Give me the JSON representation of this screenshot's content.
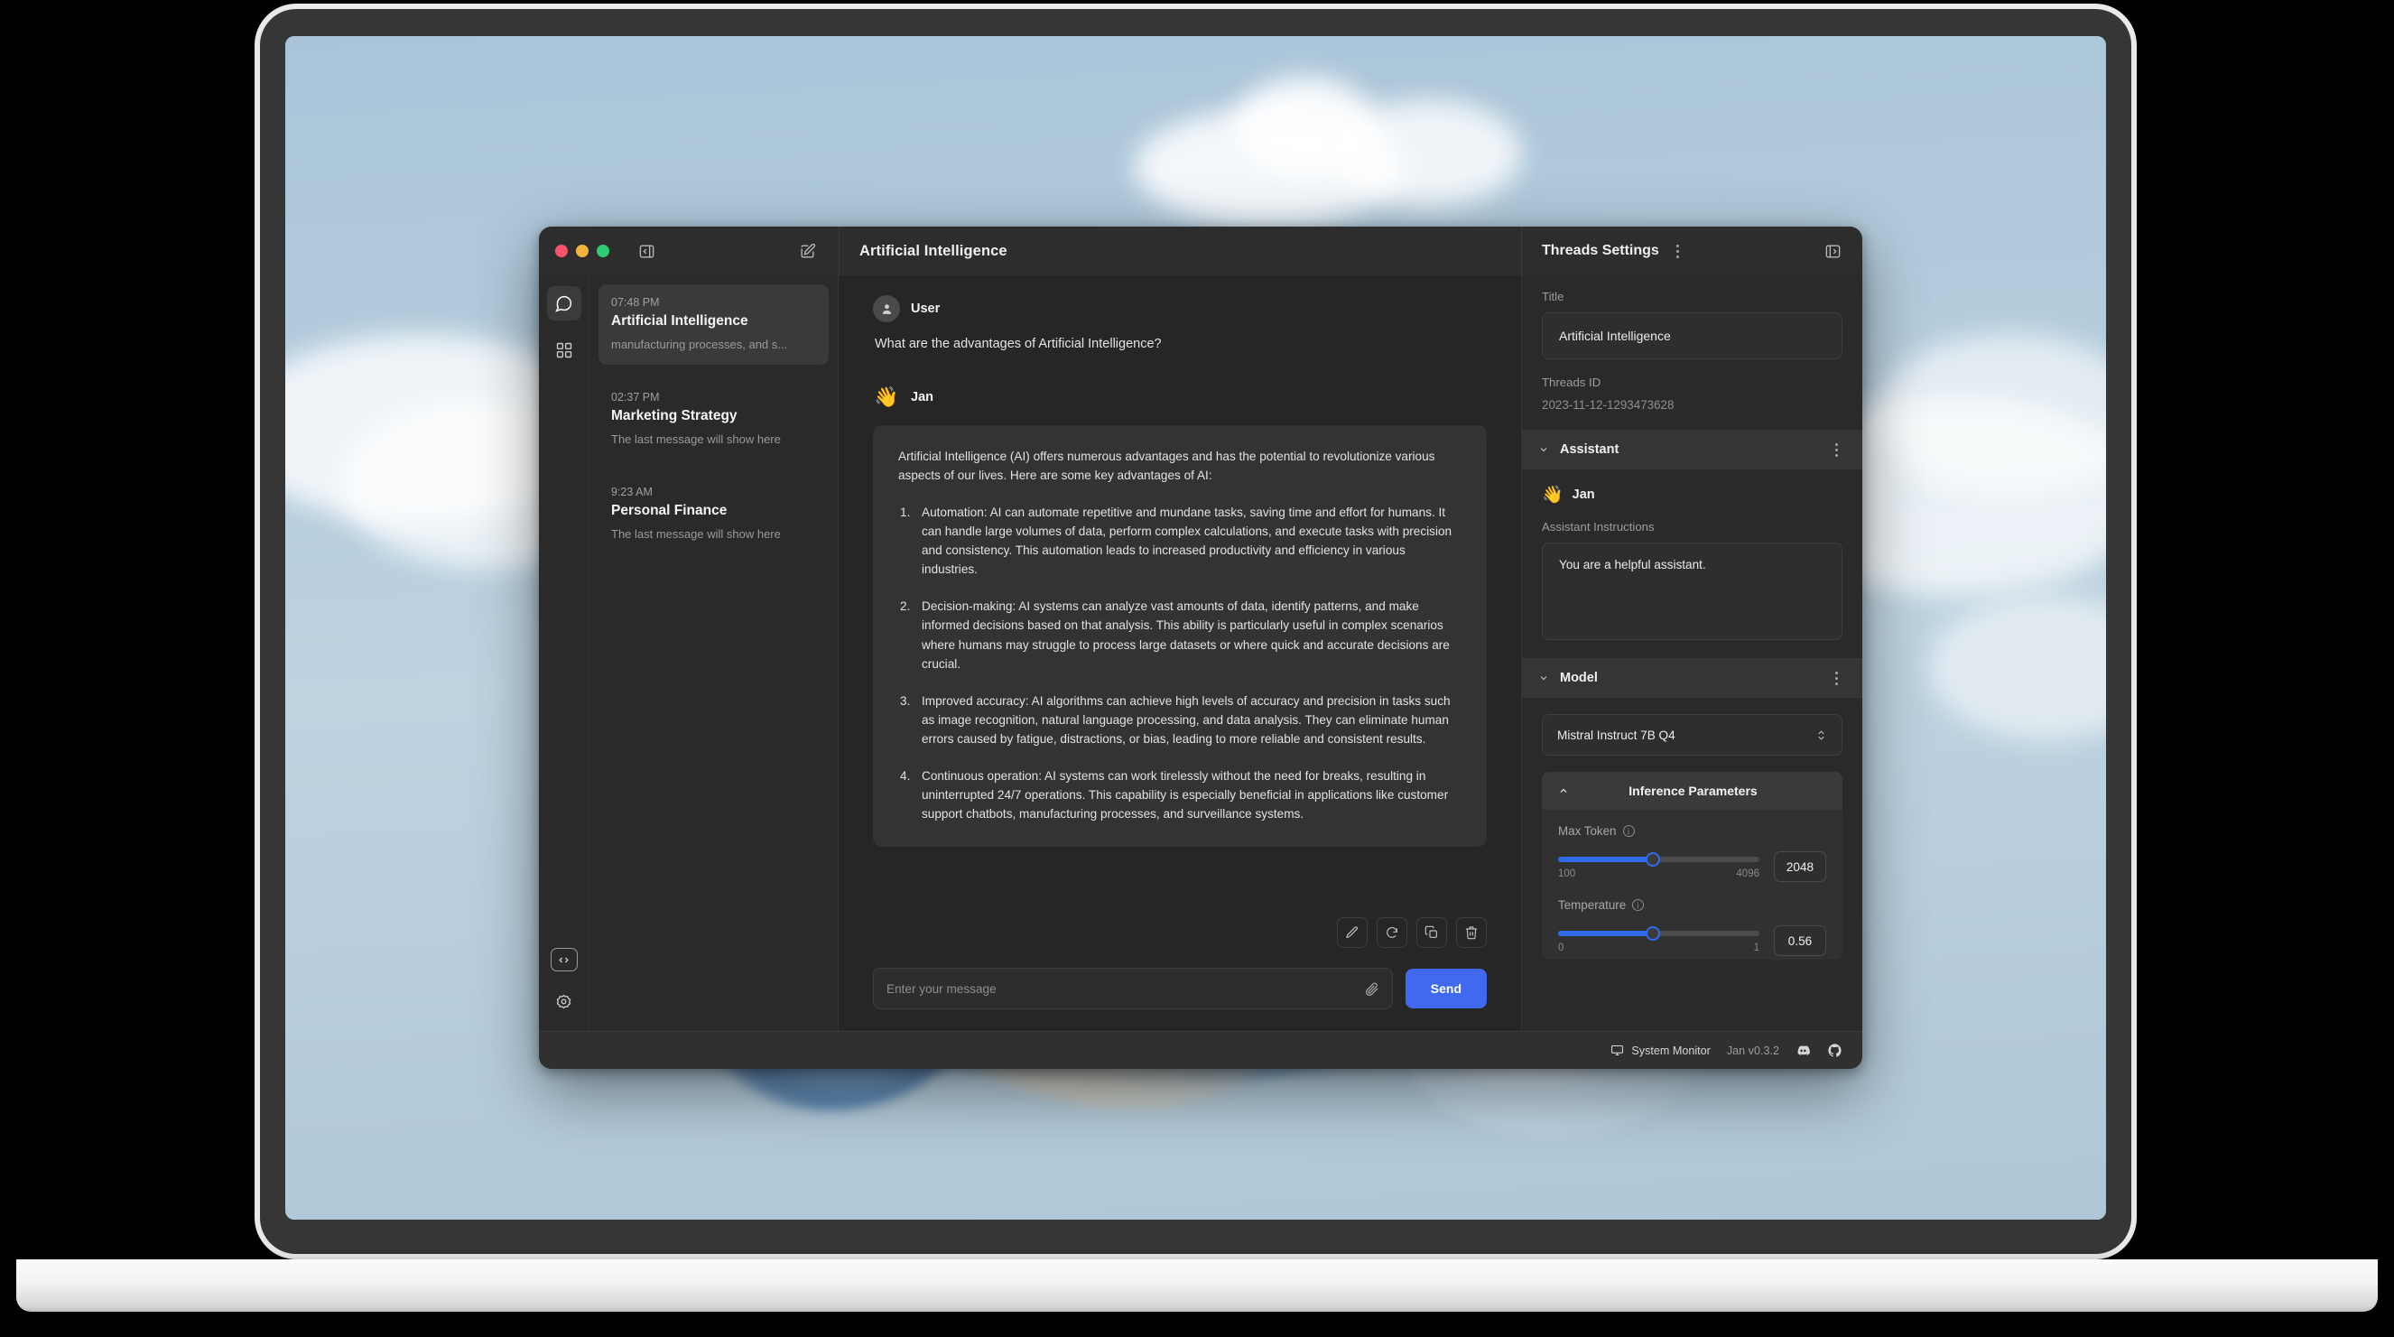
{
  "window": {
    "titlebar": {
      "toggle_left_panel_icon": "panel-left-collapse-icon",
      "new_thread_icon": "compose-pencil-square-icon",
      "chat_title": "Artificial Intelligence",
      "settings_title": "Threads Settings",
      "settings_menu_icon": "kebab-menu-icon",
      "toggle_right_panel_icon": "panel-right-collapse-icon"
    }
  },
  "rail": {
    "items": [
      {
        "name": "chat",
        "icon": "chat-bubble-icon",
        "active": true
      },
      {
        "name": "hub",
        "icon": "grid-squares-icon",
        "active": false
      }
    ],
    "bottom_items": [
      {
        "name": "local-api-server",
        "icon": "code-brackets-icon"
      },
      {
        "name": "settings",
        "icon": "gear-icon"
      }
    ]
  },
  "threads": [
    {
      "time": "07:48 PM",
      "title": "Artificial Intelligence",
      "snippet": "manufacturing processes, and s...",
      "active": true
    },
    {
      "time": "02:37 PM",
      "title": "Marketing Strategy",
      "snippet": "The last message will show here",
      "active": false
    },
    {
      "time": "9:23 AM",
      "title": "Personal Finance",
      "snippet": "The last message will show here",
      "active": false
    }
  ],
  "conversation": {
    "user": {
      "name": "User",
      "avatar_icon": "person-avatar-icon",
      "text": "What are the advantages of Artificial Intelligence?"
    },
    "assistant": {
      "name": "Jan",
      "avatar_emoji": "👋",
      "intro": "Artificial Intelligence (AI) offers numerous advantages and has the potential to revolutionize various aspects of our lives. Here are some key advantages of AI:",
      "list": [
        "Automation: AI can automate repetitive and mundane tasks, saving time and effort for humans. It can handle large volumes of data, perform complex calculations, and execute tasks with precision and consistency. This automation leads to increased productivity and efficiency in various industries.",
        "Decision-making: AI systems can analyze vast amounts of data, identify patterns, and make informed decisions based on that analysis. This ability is particularly useful in complex scenarios where humans may struggle to process large datasets or where quick and accurate decisions are crucial.",
        "Improved accuracy: AI algorithms can achieve high levels of accuracy and precision in tasks such as image recognition, natural language processing, and data analysis. They can eliminate human errors caused by fatigue, distractions, or bias, leading to more reliable and consistent results.",
        "Continuous operation: AI systems can work tirelessly without the need for breaks, resulting in uninterrupted 24/7 operations. This capability is especially beneficial in applications like customer support chatbots, manufacturing processes, and surveillance systems."
      ]
    },
    "actions": [
      {
        "name": "edit-message",
        "icon": "pencil-icon"
      },
      {
        "name": "regenerate-message",
        "icon": "refresh-icon"
      },
      {
        "name": "copy-message",
        "icon": "copy-icon"
      },
      {
        "name": "delete-message",
        "icon": "trash-icon"
      }
    ]
  },
  "composer": {
    "placeholder": "Enter your message",
    "value": "",
    "attachment_icon": "paperclip-icon",
    "send_label": "Send"
  },
  "settings_panel": {
    "title_label": "Title",
    "title_value": "Artificial Intelligence",
    "threads_id_label": "Threads ID",
    "threads_id_value": "2023-11-12-1293473628",
    "assistant_section": "Assistant",
    "assistant_emoji": "👋",
    "assistant_name": "Jan",
    "instructions_label": "Assistant Instructions",
    "instructions_value": "You are a helpful assistant.",
    "model_section": "Model",
    "model_selected": "Mistral Instruct 7B Q4",
    "inference_title": "Inference Parameters",
    "params": [
      {
        "label": "Max Token",
        "min": "100",
        "max": "4096",
        "value": "2048",
        "fill_percent": 47
      },
      {
        "label": "Temperature",
        "min": "0",
        "max": "1",
        "value": "0.56",
        "fill_percent": 47
      }
    ]
  },
  "statusbar": {
    "system_monitor_label": "System Monitor",
    "system_monitor_icon": "monitor-icon",
    "version": "Jan v0.3.2",
    "discord_icon": "discord-icon",
    "github_icon": "github-icon"
  },
  "colors": {
    "accent_blue": "#4169f0",
    "slider_blue": "#2f6bed",
    "window_bg": "#2a2a2a",
    "chat_bg": "#262626",
    "bubble_bg": "#333333",
    "traffic_red": "#f6546a",
    "traffic_yellow": "#f2b33d",
    "traffic_green": "#2fcc71"
  }
}
